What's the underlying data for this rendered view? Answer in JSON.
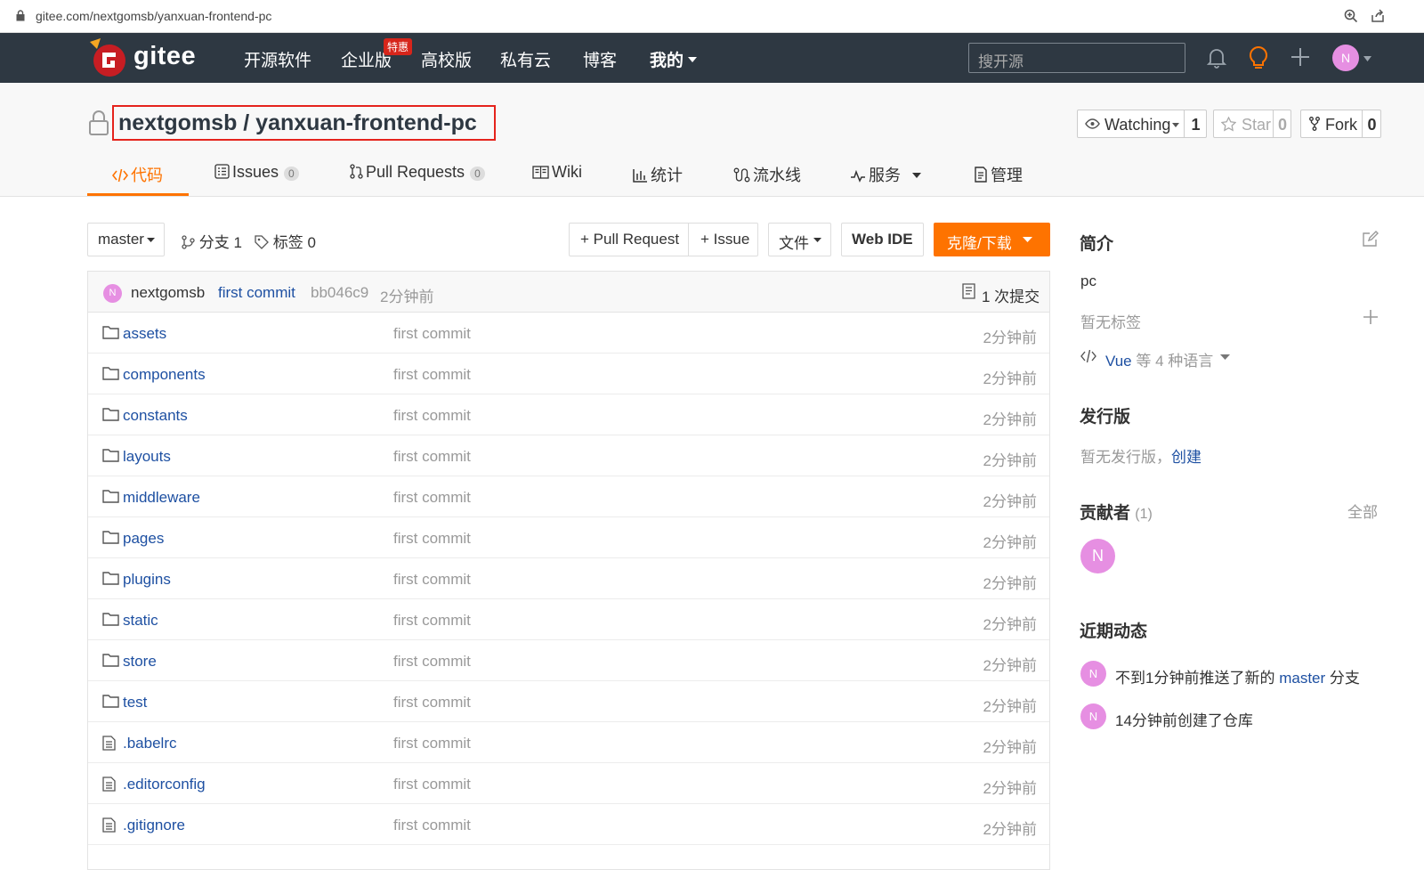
{
  "browser": {
    "url": "gitee.com/nextgomsb/yanxuan-frontend-pc"
  },
  "navbar": {
    "logo_text": "gitee",
    "items": [
      "开源软件",
      "企业版",
      "高校版",
      "私有云",
      "博客",
      "我的"
    ],
    "hot_badge": "特惠",
    "search_placeholder": "搜开源",
    "avatar_letter": "N"
  },
  "repo": {
    "title": "nextgomsb / yanxuan-frontend-pc",
    "watch_label": "Watching",
    "watch_count": "1",
    "star_label": "Star",
    "star_count": "0",
    "fork_label": "Fork",
    "fork_count": "0"
  },
  "tabs": [
    {
      "label": "代码"
    },
    {
      "label": "Issues",
      "count": "0"
    },
    {
      "label": "Pull Requests",
      "count": "0"
    },
    {
      "label": "Wiki"
    },
    {
      "label": "统计"
    },
    {
      "label": "流水线"
    },
    {
      "label": "服务"
    },
    {
      "label": "管理"
    }
  ],
  "toolbar": {
    "branch": "master",
    "branches": "分支 1",
    "tags": "标签 0",
    "pull_request": "+ Pull Request",
    "issue": "+ Issue",
    "file": "文件",
    "web_ide": "Web IDE",
    "clone": "克隆/下载"
  },
  "commit": {
    "avatar": "N",
    "author": "nextgomsb",
    "message": "first commit",
    "hash": "bb046c9",
    "time": "2分钟前",
    "count_label": "1 次提交"
  },
  "files": [
    {
      "name": "assets",
      "type": "dir",
      "msg": "first commit",
      "time": "2分钟前"
    },
    {
      "name": "components",
      "type": "dir",
      "msg": "first commit",
      "time": "2分钟前"
    },
    {
      "name": "constants",
      "type": "dir",
      "msg": "first commit",
      "time": "2分钟前"
    },
    {
      "name": "layouts",
      "type": "dir",
      "msg": "first commit",
      "time": "2分钟前"
    },
    {
      "name": "middleware",
      "type": "dir",
      "msg": "first commit",
      "time": "2分钟前"
    },
    {
      "name": "pages",
      "type": "dir",
      "msg": "first commit",
      "time": "2分钟前"
    },
    {
      "name": "plugins",
      "type": "dir",
      "msg": "first commit",
      "time": "2分钟前"
    },
    {
      "name": "static",
      "type": "dir",
      "msg": "first commit",
      "time": "2分钟前"
    },
    {
      "name": "store",
      "type": "dir",
      "msg": "first commit",
      "time": "2分钟前"
    },
    {
      "name": "test",
      "type": "dir",
      "msg": "first commit",
      "time": "2分钟前"
    },
    {
      "name": ".babelrc",
      "type": "file",
      "msg": "first commit",
      "time": "2分钟前"
    },
    {
      "name": ".editorconfig",
      "type": "file",
      "msg": "first commit",
      "time": "2分钟前"
    },
    {
      "name": ".gitignore",
      "type": "file",
      "msg": "first commit",
      "time": "2分钟前"
    }
  ],
  "sidebar": {
    "intro_title": "简介",
    "intro_text": "pc",
    "no_tags": "暂无标签",
    "lang_main": "Vue",
    "lang_rest": "等 4 种语言",
    "release_title": "发行版",
    "release_none": "暂无发行版，",
    "release_create": "创建",
    "contrib_title": "贡献者",
    "contrib_count": "(1)",
    "contrib_all": "全部",
    "contrib_avatar": "N",
    "activity_title": "近期动态",
    "activity1_pre": "不到1分钟前推送了新的",
    "activity1_branch": "master",
    "activity1_post": "分支",
    "activity2": "14分钟前创建了仓库"
  },
  "colors": {
    "accent": "#fe7300",
    "nav_bg": "#2e3842",
    "link": "#1e50a2",
    "avatar": "#e68fe2",
    "highlight_box": "#e5231c"
  }
}
